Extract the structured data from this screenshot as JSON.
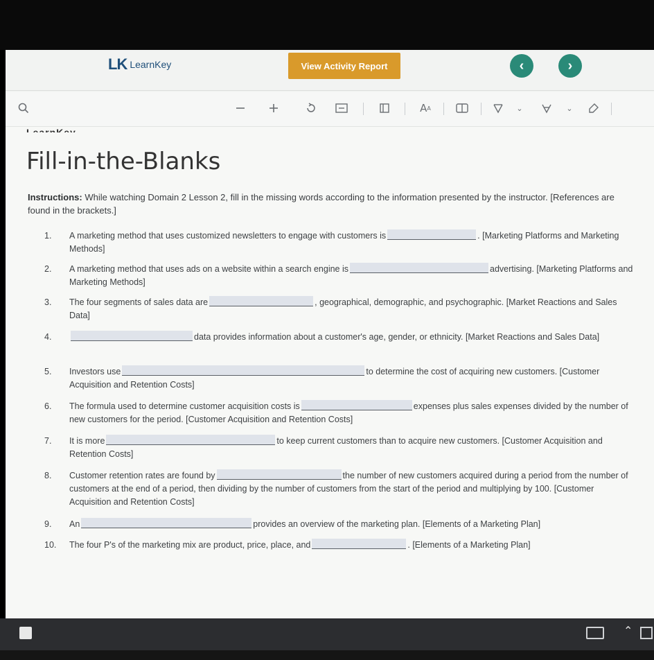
{
  "header": {
    "logo_mark": "LK",
    "logo_text": "LearnKey",
    "view_report_label": "View Activity Report",
    "prev_label": "‹",
    "next_label": "›"
  },
  "toolbar": {
    "icons": [
      "search-icon",
      "zoom-out-icon",
      "zoom-in-icon",
      "rotate-icon",
      "fit-page-icon",
      "page-view-icon",
      "text-size-icon",
      "immersive-reader-icon",
      "draw-icon",
      "highlight-icon",
      "erase-icon"
    ]
  },
  "document": {
    "title": "Fill-in-the-Blanks",
    "instructions_bold": "Instructions:",
    "instructions_text": " While watching Domain 2 Lesson 2, fill in the missing words according to the information presented by the instructor. [References are found in the brackets.]",
    "items": [
      {
        "num": "1.",
        "before": "A marketing method that uses customized newsletters to engage with customers is",
        "after": ". [Marketing Platforms and Marketing Methods]"
      },
      {
        "num": "2.",
        "before": "A marketing method that uses ads on a website within a search engine is",
        "after": "advertising. [Marketing Platforms and Marketing Methods]"
      },
      {
        "num": "3.",
        "before": "The four segments of sales data are",
        "after": ", geographical, demographic, and psychographic. [Market Reactions and Sales Data]"
      },
      {
        "num": "4.",
        "before": "",
        "after": "data provides information about a customer's age, gender, or ethnicity. [Market Reactions and Sales Data]"
      },
      {
        "num": "5.",
        "before": "Investors use",
        "after": "to determine the cost of acquiring new customers. [Customer Acquisition and Retention Costs]"
      },
      {
        "num": "6.",
        "before": "The formula used to determine customer acquisition costs is",
        "after": "expenses plus sales expenses divided by the number of new customers for the period. [Customer Acquisition and Retention Costs]"
      },
      {
        "num": "7.",
        "before": "It is more",
        "after": "to keep current customers than to acquire new customers. [Customer Acquisition and Retention Costs]"
      },
      {
        "num": "8.",
        "before": "Customer retention rates are found by",
        "after": "the number of new customers acquired during a period from the number of customers at the end of a period, then dividing by the number of customers from the start of the period and multiplying by 100. [Customer Acquisition and Retention Costs]"
      },
      {
        "num": "9.",
        "before": "An",
        "after": "provides an overview of the marketing plan. [Elements of a Marketing Plan]"
      },
      {
        "num": "10.",
        "before": "The four P's of the marketing mix are product, price, place, and",
        "after": ". [Elements of a Marketing Plan]"
      }
    ]
  },
  "taskbar": {
    "icons": [
      "start-icon",
      "keyboard-icon",
      "chevron-up-icon",
      "tray-app-icon"
    ]
  }
}
